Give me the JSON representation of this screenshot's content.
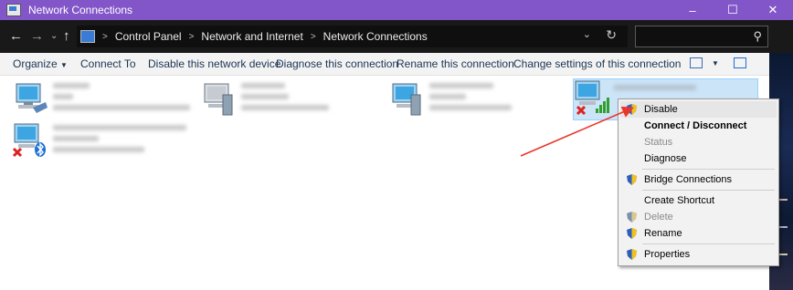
{
  "window": {
    "title": "Network Connections"
  },
  "title_controls": [
    "–",
    "☐",
    "✕"
  ],
  "nav": {
    "back": "←",
    "forward": "→",
    "history": "⌄",
    "up": "↑"
  },
  "breadcrumb": [
    "Control Panel",
    "Network and Internet",
    "Network Connections"
  ],
  "search": {
    "placeholder": ""
  },
  "commands": {
    "organize": "Organize",
    "connect_to": "Connect To",
    "disable": "Disable this network device",
    "diagnose": "Diagnose this connection",
    "rename": "Rename this connection",
    "change_settings": "Change settings of this connection"
  },
  "context_menu": {
    "items": [
      {
        "label": "Disable",
        "shield": true,
        "bold": false,
        "disabled": false
      },
      {
        "label": "Connect / Disconnect",
        "shield": false,
        "bold": true,
        "disabled": false
      },
      {
        "label": "Status",
        "shield": false,
        "bold": false,
        "disabled": true
      },
      {
        "label": "Diagnose",
        "shield": false,
        "bold": false,
        "disabled": false
      },
      {
        "label": "Bridge Connections",
        "shield": true,
        "bold": false,
        "disabled": false
      },
      {
        "label": "Create Shortcut",
        "shield": false,
        "bold": false,
        "disabled": false
      },
      {
        "label": "Delete",
        "shield": true,
        "bold": false,
        "disabled": true
      },
      {
        "label": "Rename",
        "shield": true,
        "bold": false,
        "disabled": false
      },
      {
        "label": "Properties",
        "shield": true,
        "bold": false,
        "disabled": false
      }
    ]
  },
  "colors": {
    "titlebar": "#8256c8",
    "addressbar": "#191919",
    "selection": "#cce4f7",
    "arrow": "#e8372c"
  }
}
